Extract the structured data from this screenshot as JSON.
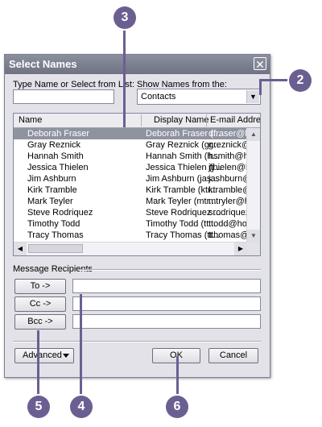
{
  "dialog": {
    "title": "Select Names",
    "close_glyph": "✕",
    "type_label": "Type Name or Select from List:",
    "type_value": "",
    "show_label": "Show Names from the:",
    "show_value": "Contacts"
  },
  "list": {
    "columns": [
      "Name",
      "Display Name",
      "E-mail Addre"
    ],
    "rows": [
      {
        "name": "Deborah Fraser",
        "display": "Deborah Fraser (...",
        "email": "dfraser@h"
      },
      {
        "name": "Gray Reznick",
        "display": "Gray Reznick (gr...",
        "email": "greznick@h"
      },
      {
        "name": "Hannah Smith",
        "display": "Hannah Smith (h...",
        "email": "hsmith@ho"
      },
      {
        "name": "Jessica Thielen",
        "display": "Jessica Thielen (j...",
        "email": "jthielen@h"
      },
      {
        "name": "Jim Ashburn",
        "display": "Jim Ashburn (jas...",
        "email": "jashburn@"
      },
      {
        "name": "Kirk Tramble",
        "display": "Kirk Tramble (ktr...",
        "email": "ktramble@"
      },
      {
        "name": "Mark Teyler",
        "display": "Mark Teyler (mtr...",
        "email": "mtryler@h"
      },
      {
        "name": "Steve Rodriquez",
        "display": "Steve Rodriquez ...",
        "email": "srodriquez"
      },
      {
        "name": "Timothy Todd",
        "display": "Timothy Todd (tt...",
        "email": "ttodd@hor"
      },
      {
        "name": "Tracy Thomas",
        "display": "Tracy Thomas (tt...",
        "email": "tthomas@h"
      }
    ],
    "selected_index": 0
  },
  "recipients": {
    "label": "Message Recipients",
    "to_label": "To ->",
    "cc_label": "Cc ->",
    "bcc_label": "Bcc ->",
    "to_value": "",
    "cc_value": "",
    "bcc_value": ""
  },
  "buttons": {
    "advanced": "Advanced",
    "ok": "OK",
    "cancel": "Cancel"
  },
  "callouts": [
    "3",
    "2",
    "5",
    "4",
    "6"
  ],
  "colors": {
    "callout": "#6b5f92",
    "selection": "#8f939f",
    "titlebar": "#7d8090"
  }
}
